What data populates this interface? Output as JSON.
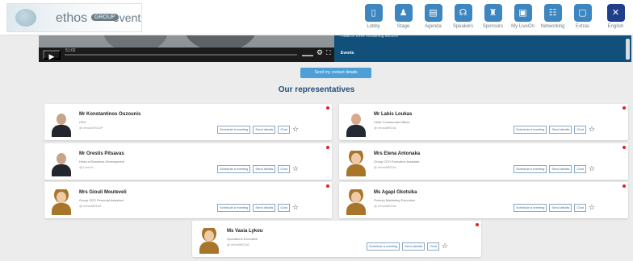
{
  "header": {
    "logo": {
      "brand": "ethos",
      "badge": "GROUP",
      "suffix": "event"
    },
    "nav": [
      {
        "label": "Lobby",
        "icon": "lobby-icon",
        "glyph": "▯"
      },
      {
        "label": "Stage",
        "icon": "stage-icon",
        "glyph": "♟"
      },
      {
        "label": "Agenda",
        "icon": "agenda-icon",
        "glyph": "▤"
      },
      {
        "label": "Speakers",
        "icon": "speakers-icon",
        "glyph": "☊"
      },
      {
        "label": "Sponsors",
        "icon": "sponsors-icon",
        "glyph": "♜"
      },
      {
        "label": "My LiveOn",
        "icon": "my-liveon-icon",
        "glyph": "▣"
      },
      {
        "label": "Networking",
        "icon": "networking-icon",
        "glyph": "☷"
      },
      {
        "label": "Extras",
        "icon": "extras-icon",
        "glyph": "▢"
      },
      {
        "label": "English",
        "icon": "uk-flag-icon",
        "glyph": "✕"
      }
    ]
  },
  "video": {
    "time": "51:02"
  },
  "events": {
    "text": "Head in three remaining sectors",
    "title": "Events"
  },
  "contact_button": "Send my contact details",
  "section_title": "Our representatives",
  "actions": {
    "meeting": "Schedule a meeting",
    "details": "Send details",
    "chat": "Chat"
  },
  "reps": [
    {
      "name": "Mr Konstantinos Ouzounis",
      "role": "CEO",
      "org": "@ ethosGROUP",
      "avatar": "male"
    },
    {
      "name": "Mr Labis Loukas",
      "role": "Chief Commercial Officer",
      "org": "@ ethosMEDIA",
      "avatar": "bald"
    },
    {
      "name": "Mr Orestis Pitsavas",
      "role": "Head of Business Development",
      "org": "@ LiveOn",
      "avatar": "male"
    },
    {
      "name": "Mrs Elena Antonaka",
      "role": "Group CEO Executive Assistant",
      "org": "@ ethosMEDIA",
      "avatar": "female"
    },
    {
      "name": "Mrs Giouli Mouteveli",
      "role": "Group CEO Personal Assistant",
      "org": "@ ethosMEDIA",
      "avatar": "female"
    },
    {
      "name": "Ms Agapi Gkotsika",
      "role": "Product Marketing Executive",
      "org": "@ ethosMEDIA",
      "avatar": "female"
    },
    {
      "name": "Ms Vasia Lykou",
      "role": "Operations Executive",
      "org": "@ ethosMEDIA",
      "avatar": "female"
    }
  ],
  "colors": {
    "accent": "#3d86bf",
    "heading": "#1f4f7b",
    "events_bg": "#10507a",
    "online_dot": "#e02020"
  }
}
